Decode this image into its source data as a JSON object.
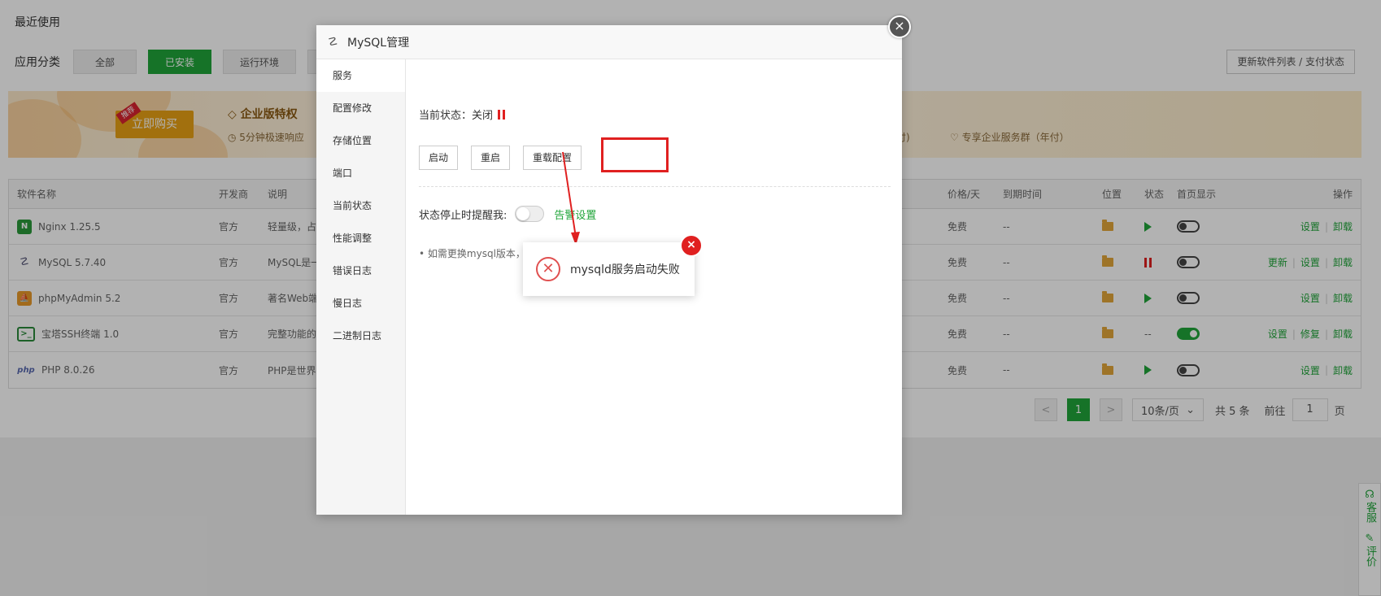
{
  "background": {
    "recent_label": "最近使用",
    "category_label": "应用分类",
    "categories": [
      "全部",
      "已安装",
      "运行环境",
      "安"
    ],
    "update_button": "更新软件列表 / 支付状态",
    "banner": {
      "buy_tag": "推荐",
      "buy_button": "立即购买",
      "title": "企业版特权",
      "sub_left": "5分钟极速响应",
      "sub_right1": "年付)",
      "sub_right2": "专享企业服务群（年付）"
    },
    "table": {
      "headers": {
        "name": "软件名称",
        "developer": "开发商",
        "description": "说明",
        "price": "价格/天",
        "expire": "到期时间",
        "location": "位置",
        "status": "状态",
        "home": "首页显示",
        "ops": "操作"
      },
      "rows": [
        {
          "name": "Nginx 1.25.5",
          "developer": "官方",
          "description": "轻量级，占",
          "price": "免费",
          "expire": "--",
          "ops": [
            "设置",
            "卸载"
          ]
        },
        {
          "name": "MySQL 5.7.40",
          "developer": "官方",
          "description": "MySQL是一",
          "price": "免费",
          "expire": "--",
          "ops": [
            "更新",
            "设置",
            "卸载"
          ]
        },
        {
          "name": "phpMyAdmin 5.2",
          "developer": "官方",
          "description": "著名Web端",
          "price": "免费",
          "expire": "--",
          "ops": [
            "设置",
            "卸载"
          ]
        },
        {
          "name": "宝塔SSH终端 1.0",
          "developer": "官方",
          "description": "完整功能的",
          "price": "免费",
          "expire": "--",
          "status_text": "--",
          "ops": [
            "设置",
            "修复",
            "卸载"
          ]
        },
        {
          "name": "PHP 8.0.26",
          "developer": "官方",
          "description": "PHP是世界",
          "price": "免费",
          "expire": "--",
          "ops": [
            "设置",
            "卸载"
          ]
        }
      ]
    },
    "pager": {
      "prev": "<",
      "page": "1",
      "next": ">",
      "per_page": "10条/页",
      "total": "共 5 条",
      "goto_label": "前往",
      "goto_value": "1",
      "page_suffix": "页"
    },
    "side_float": {
      "service": "客服",
      "review": "评价"
    }
  },
  "modal": {
    "title": "MySQL管理",
    "close": "×",
    "menu": [
      "服务",
      "配置修改",
      "存储位置",
      "端口",
      "当前状态",
      "性能调整",
      "错误日志",
      "慢日志",
      "二进制日志"
    ],
    "status_label": "当前状态：",
    "status_value": "关闭",
    "buttons": [
      "启动",
      "重启",
      "重载配置"
    ],
    "remind_label": "状态停止时提醒我:",
    "alarm_link": "告警设置",
    "tip": "如需更换mysql版本，请备份好数据后，卸载mysql重新安装"
  },
  "toast": {
    "message": "mysqld服务启动失败",
    "icon": "error-x-icon",
    "close": "×"
  },
  "colors": {
    "accent": "#20a53a",
    "error": "#e02020"
  }
}
